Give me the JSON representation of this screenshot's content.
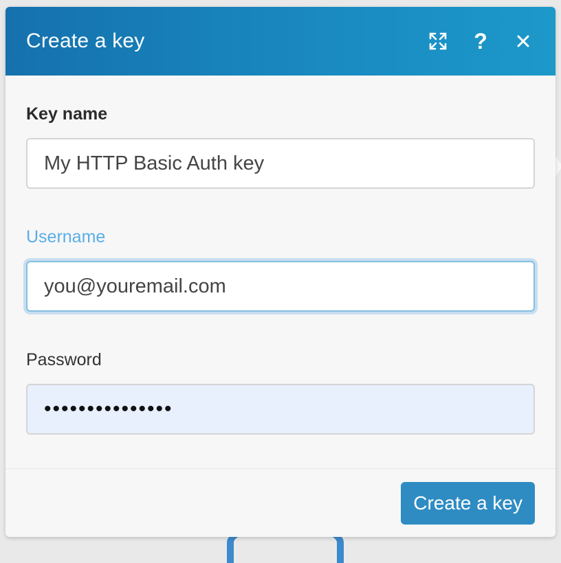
{
  "dialog": {
    "title": "Create a key",
    "header_icons": [
      "expand-icon",
      "help-icon",
      "close-icon"
    ],
    "help_glyph": "?",
    "accent_color": "#1a8bc2"
  },
  "form": {
    "key_name": {
      "label": "Key name",
      "value": "My HTTP Basic Auth key"
    },
    "username": {
      "label": "Username",
      "value": "you@youremail.com"
    },
    "password": {
      "label": "Password",
      "value": "•••••••••••••••"
    }
  },
  "footer": {
    "submit_label": "Create a key",
    "submit_color": "#2f8cc3"
  }
}
